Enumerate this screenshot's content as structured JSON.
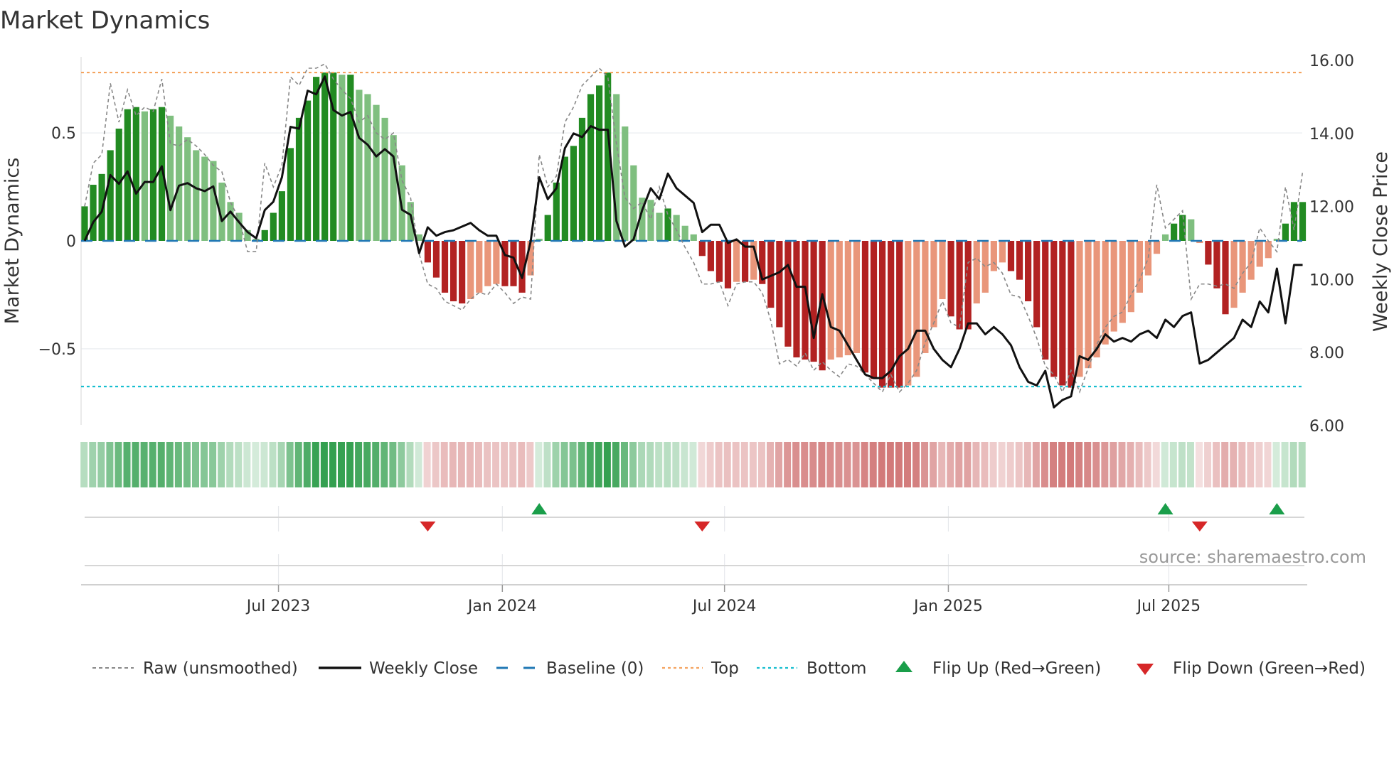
{
  "chart_data": {
    "type": "bar",
    "title": "Market Dynamics",
    "ylabel": "Market Dynamics",
    "y2label": "Weekly Close Price",
    "ylim": [
      -0.8,
      0.85
    ],
    "y2lim": [
      6,
      16
    ],
    "yticks": [
      {
        "v": 0.5,
        "label": "0.5"
      },
      {
        "v": 0,
        "label": "0"
      },
      {
        "v": -0.5,
        "label": "−0.5"
      }
    ],
    "y2ticks": [
      {
        "v": 16,
        "label": "16.00"
      },
      {
        "v": 14,
        "label": "14.00"
      },
      {
        "v": 12,
        "label": "12.00"
      },
      {
        "v": 10,
        "label": "10.00"
      },
      {
        "v": 8,
        "label": "8.00"
      },
      {
        "v": 6,
        "label": "6.00"
      }
    ],
    "xticks": [
      {
        "week": 22.6,
        "label": "Jul 2023"
      },
      {
        "week": 48.7,
        "label": "Jan 2024"
      },
      {
        "week": 74.6,
        "label": "Jul 2024"
      },
      {
        "week": 100.7,
        "label": "Jan 2025"
      },
      {
        "week": 126.4,
        "label": "Jul 2025"
      }
    ],
    "top_level": 0.78,
    "bottom_level": -0.675,
    "baseline": 0,
    "values": [
      0.16,
      0.26,
      0.31,
      0.42,
      0.52,
      0.61,
      0.62,
      0.6,
      0.61,
      0.62,
      0.58,
      0.53,
      0.48,
      0.42,
      0.39,
      0.37,
      0.27,
      0.18,
      0.13,
      0.05,
      0.01,
      0.05,
      0.13,
      0.23,
      0.43,
      0.57,
      0.65,
      0.76,
      0.78,
      0.78,
      0.77,
      0.77,
      0.7,
      0.68,
      0.63,
      0.57,
      0.49,
      0.35,
      0.18,
      0.03,
      -0.1,
      -0.17,
      -0.24,
      -0.28,
      -0.29,
      -0.27,
      -0.24,
      -0.21,
      -0.2,
      -0.21,
      -0.21,
      -0.24,
      -0.16,
      0.01,
      0.12,
      0.27,
      0.39,
      0.44,
      0.57,
      0.68,
      0.72,
      0.78,
      0.68,
      0.53,
      0.35,
      0.2,
      0.19,
      0.13,
      0.15,
      0.12,
      0.07,
      0.03,
      -0.07,
      -0.14,
      -0.19,
      -0.22,
      -0.19,
      -0.19,
      -0.18,
      -0.2,
      -0.31,
      -0.4,
      -0.49,
      -0.54,
      -0.55,
      -0.56,
      -0.6,
      -0.55,
      -0.54,
      -0.53,
      -0.52,
      -0.61,
      -0.64,
      -0.68,
      -0.68,
      -0.68,
      -0.67,
      -0.63,
      -0.52,
      -0.4,
      -0.27,
      -0.35,
      -0.41,
      -0.41,
      -0.29,
      -0.24,
      -0.14,
      -0.1,
      -0.14,
      -0.18,
      -0.28,
      -0.4,
      -0.55,
      -0.63,
      -0.67,
      -0.68,
      -0.63,
      -0.59,
      -0.54,
      -0.48,
      -0.42,
      -0.38,
      -0.33,
      -0.24,
      -0.16,
      -0.06,
      0.03,
      0.08,
      0.12,
      0.1,
      -0.01,
      -0.11,
      -0.22,
      -0.34,
      -0.31,
      -0.24,
      -0.18,
      -0.12,
      -0.08,
      0.01,
      0.08,
      0.18,
      0.18
    ],
    "raw": [
      0.16,
      0.36,
      0.4,
      0.73,
      0.55,
      0.7,
      0.58,
      0.62,
      0.6,
      0.75,
      0.45,
      0.44,
      0.47,
      0.44,
      0.4,
      0.35,
      0.32,
      0.18,
      0.1,
      -0.05,
      -0.05,
      0.36,
      0.25,
      0.35,
      0.76,
      0.72,
      0.8,
      0.8,
      0.82,
      0.75,
      0.7,
      0.66,
      0.55,
      0.58,
      0.5,
      0.47,
      0.5,
      0.28,
      0.2,
      -0.06,
      -0.2,
      -0.22,
      -0.28,
      -0.3,
      -0.32,
      -0.27,
      -0.24,
      -0.25,
      -0.2,
      -0.24,
      -0.29,
      -0.26,
      -0.27,
      0.4,
      0.25,
      0.3,
      0.55,
      0.62,
      0.72,
      0.76,
      0.8,
      0.76,
      0.45,
      0.2,
      0.15,
      0.18,
      0.1,
      0.25,
      0.12,
      0.05,
      -0.03,
      -0.1,
      -0.2,
      -0.2,
      -0.19,
      -0.3,
      -0.2,
      -0.19,
      -0.19,
      -0.24,
      -0.37,
      -0.57,
      -0.55,
      -0.58,
      -0.52,
      -0.6,
      -0.56,
      -0.6,
      -0.63,
      -0.57,
      -0.58,
      -0.62,
      -0.66,
      -0.7,
      -0.62,
      -0.7,
      -0.66,
      -0.6,
      -0.47,
      -0.38,
      -0.28,
      -0.38,
      -0.4,
      -0.1,
      -0.08,
      -0.12,
      -0.1,
      -0.15,
      -0.25,
      -0.26,
      -0.35,
      -0.45,
      -0.58,
      -0.62,
      -0.7,
      -0.6,
      -0.7,
      -0.59,
      -0.48,
      -0.4,
      -0.35,
      -0.33,
      -0.25,
      -0.18,
      -0.08,
      0.26,
      0.06,
      0.1,
      0.14,
      -0.27,
      -0.2,
      -0.2,
      -0.21,
      -0.2,
      -0.22,
      -0.15,
      -0.1,
      0.06,
      0.0,
      -0.05,
      0.25,
      0.05,
      0.32
    ],
    "close": [
      11.06,
      11.57,
      11.86,
      12.86,
      12.62,
      12.96,
      12.35,
      12.67,
      12.67,
      13.1,
      11.9,
      12.57,
      12.64,
      12.5,
      12.42,
      12.55,
      11.6,
      11.86,
      11.57,
      11.3,
      11.13,
      11.9,
      12.13,
      12.8,
      14.18,
      14.13,
      15.17,
      15.07,
      15.56,
      14.64,
      14.49,
      14.59,
      13.88,
      13.69,
      13.37,
      13.57,
      13.37,
      11.91,
      11.77,
      10.72,
      11.43,
      11.2,
      11.3,
      11.35,
      11.45,
      11.55,
      11.35,
      11.2,
      11.2,
      10.67,
      10.6,
      10.04,
      11.04,
      12.8,
      12.2,
      12.5,
      13.6,
      14.0,
      13.9,
      14.2,
      14.1,
      14.1,
      11.6,
      10.9,
      11.1,
      11.9,
      12.5,
      12.2,
      12.9,
      12.5,
      12.3,
      12.1,
      11.3,
      11.5,
      11.5,
      11.0,
      11.1,
      10.9,
      10.9,
      10.0,
      10.1,
      10.2,
      10.4,
      9.8,
      9.8,
      8.4,
      9.6,
      8.7,
      8.6,
      8.2,
      7.8,
      7.4,
      7.3,
      7.3,
      7.5,
      7.9,
      8.1,
      8.6,
      8.6,
      8.1,
      7.8,
      7.6,
      8.1,
      8.8,
      8.8,
      8.5,
      8.7,
      8.5,
      8.2,
      7.6,
      7.2,
      7.1,
      7.5,
      6.5,
      6.7,
      6.8,
      7.9,
      7.8,
      8.1,
      8.5,
      8.3,
      8.4,
      8.3,
      8.5,
      8.6,
      8.4,
      8.9,
      8.7,
      9.0,
      9.1,
      7.7,
      7.8,
      8.0,
      8.2,
      8.4,
      8.9,
      8.7,
      9.4,
      9.1,
      10.3,
      8.8,
      10.4,
      10.4
    ],
    "flip_up_weeks": [
      53,
      126,
      139
    ],
    "flip_down_weeks": [
      40,
      72,
      130
    ],
    "legend": {
      "placement": "bottom",
      "raw": "Raw (unsmoothed)",
      "close": "Weekly Close",
      "baseline": "Baseline (0)",
      "top": "Top",
      "bottom": "Bottom",
      "flip_up": "Flip Up (Red→Green)",
      "flip_down": "Flip Down (Green→Red)"
    },
    "source": "source: sharemaestro.com",
    "colors": {
      "strong_green": "#228b22",
      "weak_green": "#7fbf7f",
      "strong_red": "#b22222",
      "weak_red": "#e9967a",
      "raw": "#888888",
      "close": "#111111",
      "baseline": "#1f77b4",
      "top": "#f4a460",
      "bottom": "#17becf",
      "flip_up": "#1a9e4a",
      "flip_down": "#d62728"
    }
  }
}
